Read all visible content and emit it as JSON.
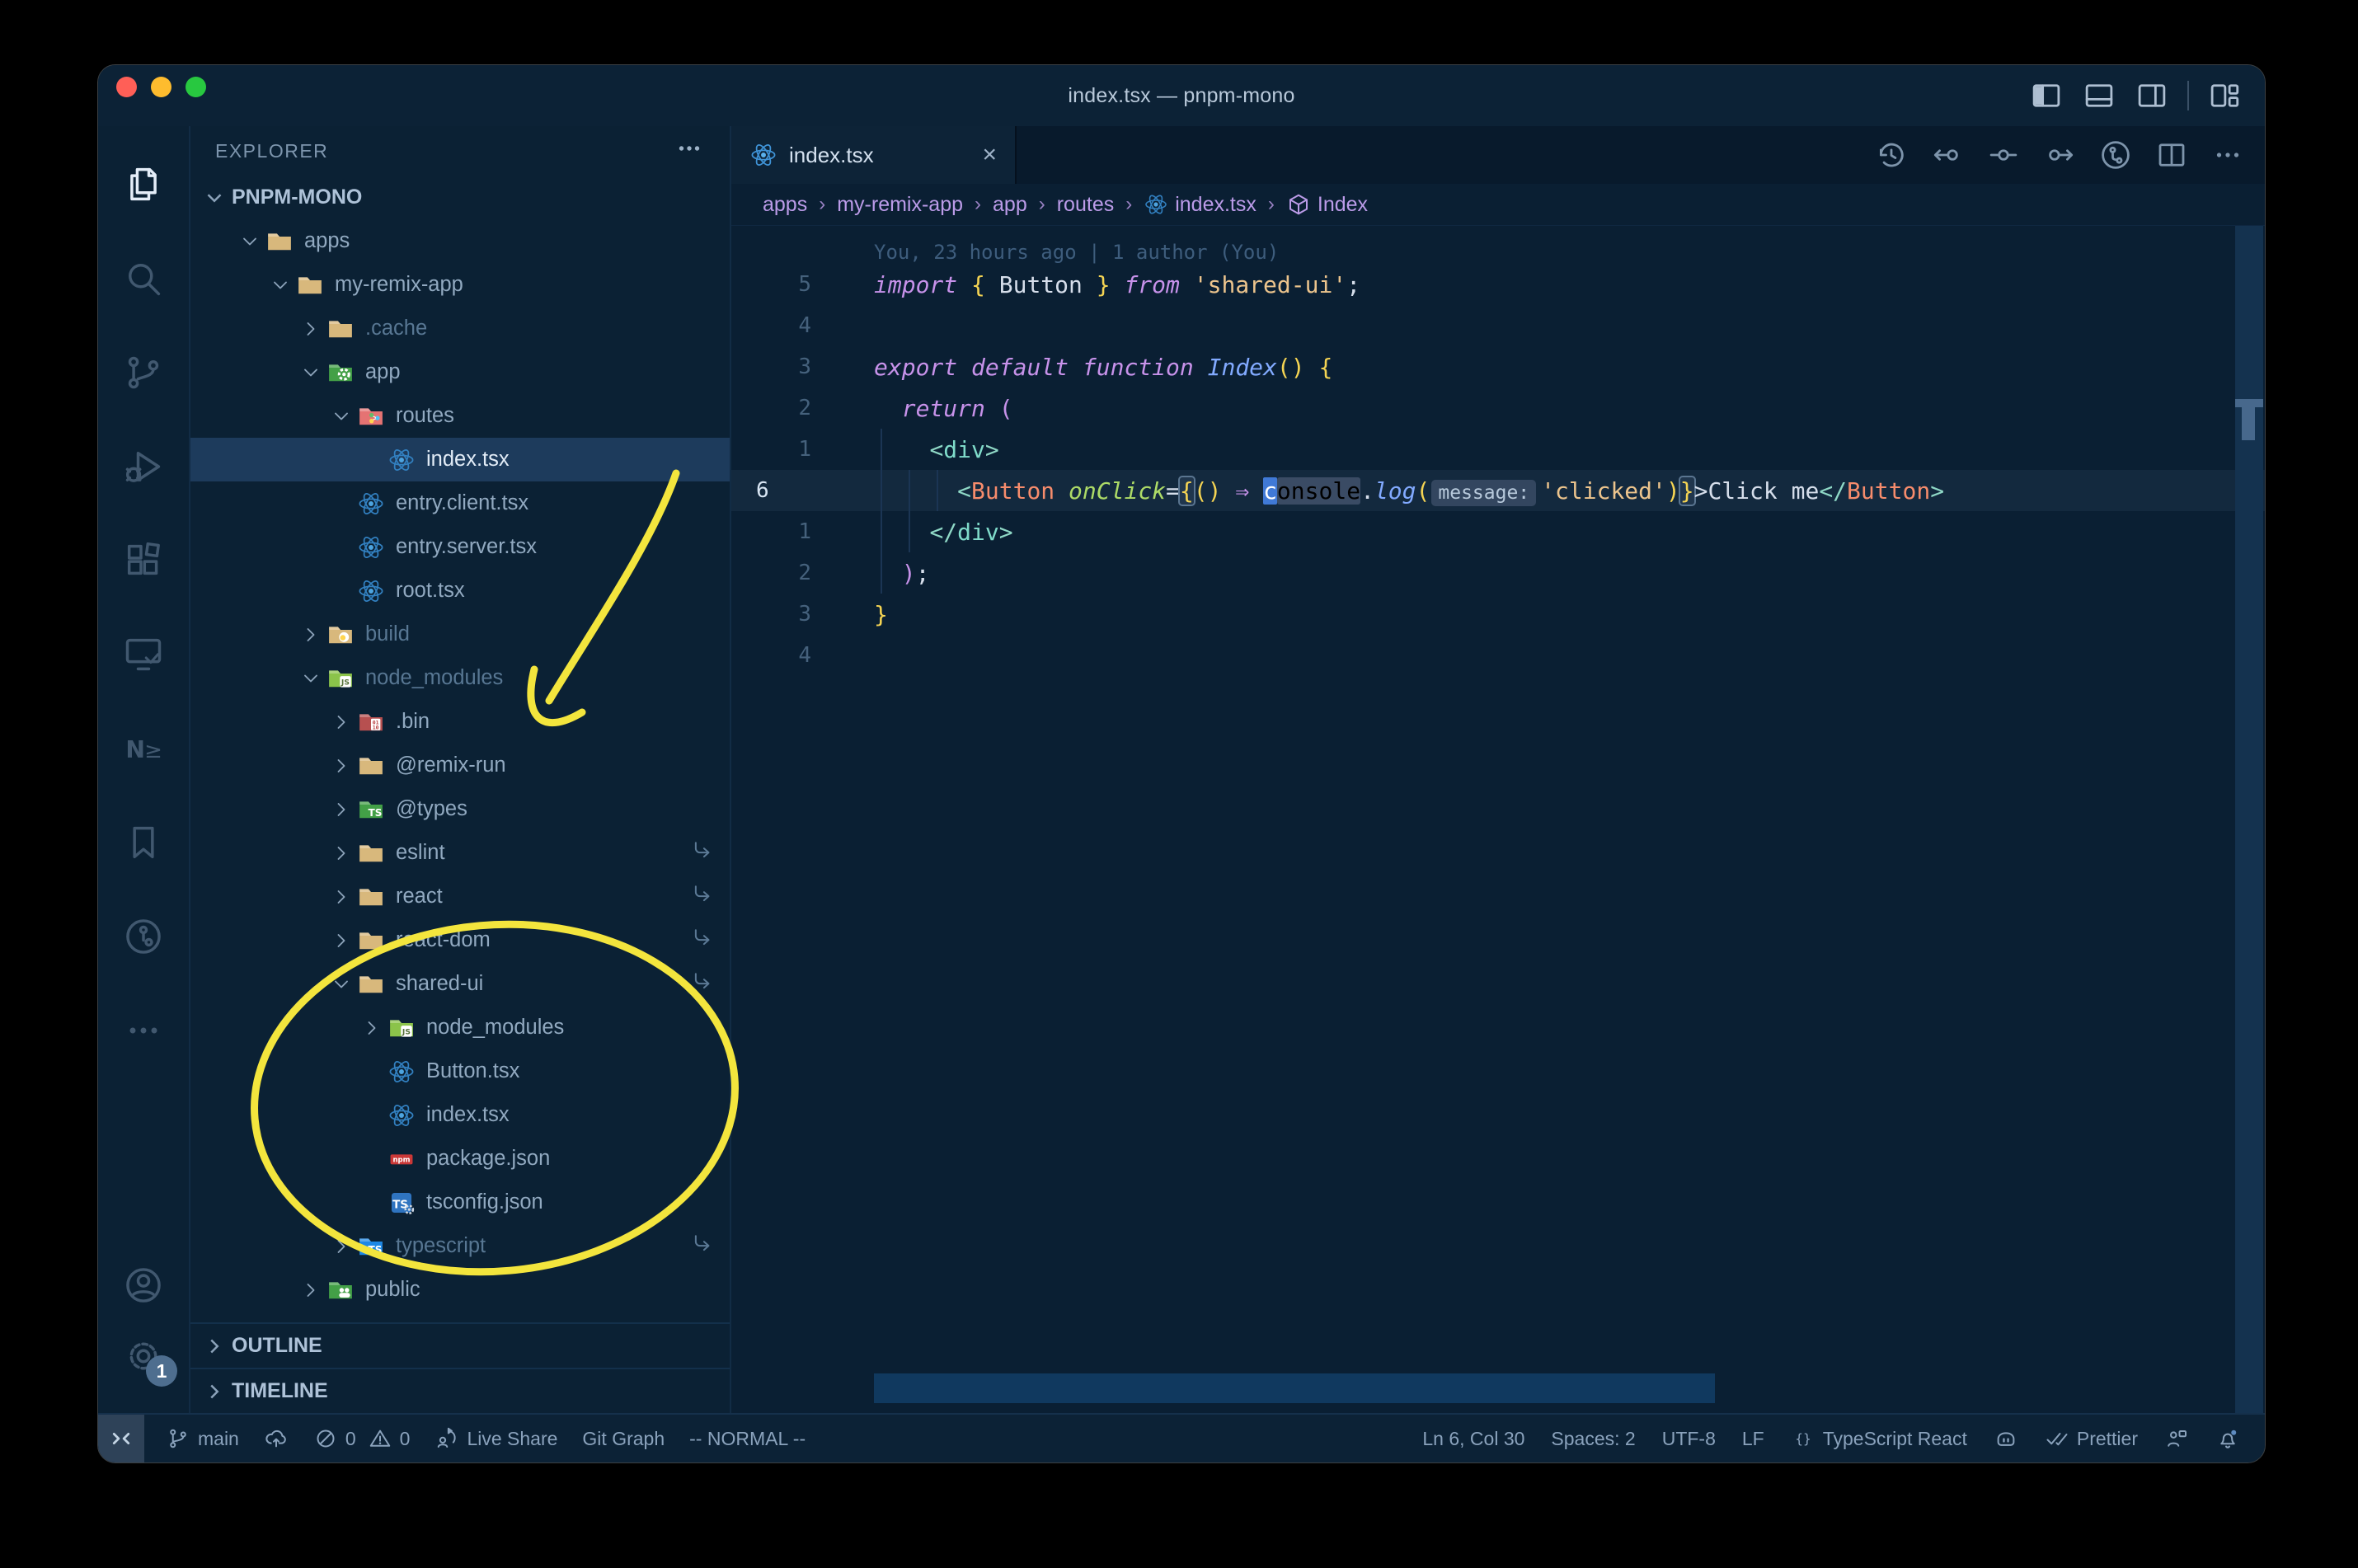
{
  "window": {
    "title": "index.tsx — pnpm-mono"
  },
  "titlebar": {
    "layout_icons": [
      "layout-sidebar-left",
      "layout-panel",
      "layout-sidebar-right",
      "layout-customize"
    ]
  },
  "activity_bar": {
    "top": [
      {
        "icon": "files",
        "active": true
      },
      {
        "icon": "search"
      },
      {
        "icon": "source-control"
      },
      {
        "icon": "run-debug"
      },
      {
        "icon": "extensions"
      },
      {
        "icon": "remote-explorer"
      },
      {
        "icon": "nx-console"
      },
      {
        "icon": "bookmarks"
      },
      {
        "icon": "gitlens"
      },
      {
        "icon": "more-views"
      }
    ],
    "bottom": [
      {
        "icon": "account"
      },
      {
        "icon": "settings-gear",
        "badge": "1"
      }
    ]
  },
  "explorer": {
    "header": "EXPLORER",
    "project": "PNPM-MONO",
    "outline_label": "OUTLINE",
    "timeline_label": "TIMELINE"
  },
  "tree": [
    {
      "label": "apps",
      "level": 1,
      "chevron": "down",
      "icon": "folder"
    },
    {
      "label": "my-remix-app",
      "level": 2,
      "chevron": "down",
      "icon": "folder"
    },
    {
      "label": ".cache",
      "level": 3,
      "chevron": "right",
      "icon": "folder",
      "dim": true
    },
    {
      "label": "app",
      "level": 3,
      "chevron": "down",
      "icon": "folder-app"
    },
    {
      "label": "routes",
      "level": 4,
      "chevron": "down",
      "icon": "folder-routes"
    },
    {
      "label": "index.tsx",
      "level": 5,
      "icon": "react",
      "selected": true
    },
    {
      "label": "entry.client.tsx",
      "level": 4,
      "icon": "react"
    },
    {
      "label": "entry.server.tsx",
      "level": 4,
      "icon": "react"
    },
    {
      "label": "root.tsx",
      "level": 4,
      "icon": "react"
    },
    {
      "label": "build",
      "level": 3,
      "chevron": "right",
      "icon": "folder-build",
      "dim": true
    },
    {
      "label": "node_modules",
      "level": 3,
      "chevron": "down",
      "icon": "folder-node",
      "dim": true
    },
    {
      "label": ".bin",
      "level": 4,
      "chevron": "right",
      "icon": "folder-bin"
    },
    {
      "label": "@remix-run",
      "level": 4,
      "chevron": "right",
      "icon": "folder"
    },
    {
      "label": "@types",
      "level": 4,
      "chevron": "right",
      "icon": "folder-types"
    },
    {
      "label": "eslint",
      "level": 4,
      "chevron": "right",
      "icon": "folder",
      "symlink": true
    },
    {
      "label": "react",
      "level": 4,
      "chevron": "right",
      "icon": "folder",
      "symlink": true
    },
    {
      "label": "react-dom",
      "level": 4,
      "chevron": "right",
      "icon": "folder",
      "symlink": true
    },
    {
      "label": "shared-ui",
      "level": 4,
      "chevron": "down",
      "icon": "folder",
      "symlink": true
    },
    {
      "label": "node_modules",
      "level": 5,
      "chevron": "right",
      "icon": "folder-node"
    },
    {
      "label": "Button.tsx",
      "level": 5,
      "icon": "react"
    },
    {
      "label": "index.tsx",
      "level": 5,
      "icon": "react"
    },
    {
      "label": "package.json",
      "level": 5,
      "icon": "npm"
    },
    {
      "label": "tsconfig.json",
      "level": 5,
      "icon": "tsconfig"
    },
    {
      "label": "typescript",
      "level": 4,
      "chevron": "right",
      "icon": "folder-ts",
      "dim": true,
      "symlink": true
    },
    {
      "label": "public",
      "level": 3,
      "chevron": "right",
      "icon": "folder-public"
    }
  ],
  "editor": {
    "tab": {
      "label": "index.tsx",
      "icon": "react",
      "close": "×"
    },
    "actions": [
      "history",
      "change-prev",
      "change",
      "change-next",
      "gitlens-graph",
      "split-editor",
      "ellipsis"
    ],
    "breadcrumbs": [
      {
        "label": "apps"
      },
      {
        "label": "my-remix-app"
      },
      {
        "label": "app"
      },
      {
        "label": "routes"
      },
      {
        "label": "index.tsx",
        "icon": "react"
      },
      {
        "label": "Index",
        "icon": "symbol-cube"
      }
    ],
    "gitlens_blame": "You, 23 hours ago | 1 author (You)",
    "lines": [
      {
        "num": "5",
        "spans": [
          [
            "import",
            "kw"
          ],
          [
            " ",
            "pl"
          ],
          [
            "{",
            "gold"
          ],
          [
            " Button ",
            "fg"
          ],
          [
            "}",
            "gold"
          ],
          [
            " ",
            "pl"
          ],
          [
            "from",
            "kw"
          ],
          [
            " ",
            "pl"
          ],
          [
            "'shared-ui'",
            "str"
          ],
          [
            ";",
            "fg"
          ]
        ]
      },
      {
        "num": "4",
        "spans": []
      },
      {
        "num": "3",
        "spans": [
          [
            "export",
            "kw"
          ],
          [
            " ",
            "pl"
          ],
          [
            "default",
            "kw"
          ],
          [
            " ",
            "pl"
          ],
          [
            "function",
            "kw"
          ],
          [
            " ",
            "pl"
          ],
          [
            "Index",
            "fn"
          ],
          [
            "()",
            "gold"
          ],
          [
            " ",
            "pl"
          ],
          [
            "{",
            "gold"
          ]
        ]
      },
      {
        "num": "2",
        "spans": [
          [
            "  ",
            "pl"
          ],
          [
            "return",
            "kw"
          ],
          [
            " ",
            "pl"
          ],
          [
            "(",
            "pink"
          ]
        ]
      },
      {
        "num": "1",
        "spans": [
          [
            "    ",
            "pl"
          ],
          [
            "<",
            "tagp"
          ],
          [
            "div",
            "tag"
          ],
          [
            ">",
            "tagp"
          ]
        ]
      },
      {
        "num": "6",
        "current": true,
        "spans": [
          [
            "      ",
            "pl"
          ],
          [
            "<",
            "tagp"
          ],
          [
            "Button",
            "comp"
          ],
          [
            " ",
            "pl"
          ],
          [
            "onClick",
            "attr"
          ],
          [
            "=",
            "fg"
          ],
          [
            "{",
            "gold box"
          ],
          [
            "()",
            "gold"
          ],
          [
            " ",
            "pl"
          ],
          [
            "⇒",
            "kw"
          ],
          [
            " ",
            "pl"
          ],
          [
            "c",
            "cursor"
          ],
          [
            "onsole",
            "word"
          ],
          [
            ".",
            "fg"
          ],
          [
            "log",
            "fn"
          ],
          [
            "(",
            "gold"
          ],
          [
            "message:",
            "inlay"
          ],
          [
            "'clicked'",
            "str"
          ],
          [
            ")",
            "gold"
          ],
          [
            "}",
            "gold box"
          ],
          [
            ">",
            "fg"
          ],
          [
            "Click me",
            "fg"
          ],
          [
            "</",
            "tagp"
          ],
          [
            "Button",
            "comp"
          ],
          [
            ">",
            "tagp"
          ]
        ]
      },
      {
        "num": "1",
        "spans": [
          [
            "    ",
            "pl"
          ],
          [
            "</",
            "tagp"
          ],
          [
            "div",
            "tag"
          ],
          [
            ">",
            "tagp"
          ]
        ]
      },
      {
        "num": "2",
        "spans": [
          [
            "  ",
            "pl"
          ],
          [
            ")",
            "pink"
          ],
          [
            ";",
            "fg"
          ]
        ]
      },
      {
        "num": "3",
        "spans": [
          [
            "}",
            "gold"
          ]
        ]
      },
      {
        "num": "4",
        "spans": []
      }
    ]
  },
  "status_bar": {
    "left": [
      {
        "icon": "source-branch",
        "label": "main"
      },
      {
        "icon": "cloud-upload"
      },
      {
        "icon": "error-slash",
        "label": "0"
      },
      {
        "icon": "warning-triangle",
        "label": "0",
        "tight": true
      },
      {
        "icon": "live-share",
        "label": "Live Share"
      },
      {
        "label": "Git Graph"
      },
      {
        "label": "-- NORMAL --"
      }
    ],
    "right": [
      {
        "label": "Ln 6, Col 30"
      },
      {
        "label": "Spaces: 2"
      },
      {
        "label": "UTF-8"
      },
      {
        "label": "LF"
      },
      {
        "icon": "braces",
        "label": "TypeScript React"
      },
      {
        "icon": "copilot"
      },
      {
        "icon": "double-check",
        "label": "Prettier"
      },
      {
        "icon": "feedback"
      },
      {
        "icon": "bell-dot"
      }
    ]
  },
  "annotations": {
    "color": "#f3e53d"
  },
  "colors": {
    "editor_bg": "#0a1f33",
    "sidebar_bg": "#0b2134",
    "selection_row": "#1d3b5c",
    "keyword": "#c792ea",
    "string": "#ecc48d",
    "tag": "#7fdbca",
    "component": "#f78c6c",
    "attribute": "#addb67",
    "function": "#82aaff",
    "bracket": "#f5d453",
    "traffic_red": "#ff5f57",
    "traffic_yellow": "#febc2e",
    "traffic_green": "#28c840"
  }
}
